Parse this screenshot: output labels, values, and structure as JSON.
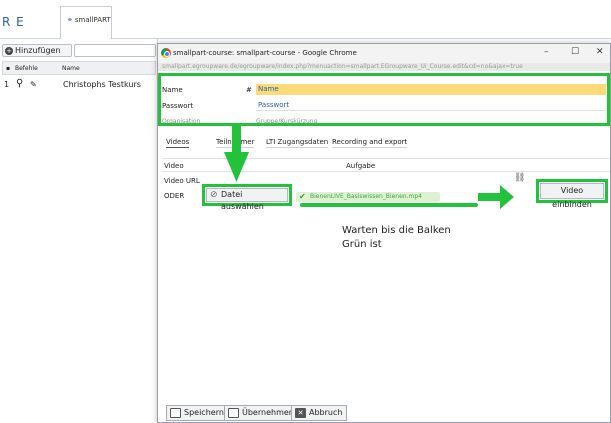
{
  "topbar": {
    "brand_partial": "R E",
    "app_tab_label": "smallPART"
  },
  "left_panel": {
    "add_button": "Hinzufügen",
    "columns": [
      "Befehle",
      "Name"
    ],
    "rows": [
      {
        "id": "1",
        "name": "Christophs Testkurs"
      }
    ]
  },
  "chrome_window": {
    "title": "smallpart-course: smallpart-course - Google Chrome",
    "url_text": "smallpart.egroupware.de/egroupware/index.php?menuaction=smallpart.EGroupware_Ui_Course.edit&cd=no&ajax=true",
    "controls": [
      "–",
      "☐",
      "✕"
    ]
  },
  "form": {
    "name_label": "Name",
    "name_hash": "#",
    "name_placeholder": "Name",
    "password_label": "Passwort",
    "password_placeholder": "Passwort",
    "org_label": "Organisation",
    "group_label": "Gruppe/Kurskürzung"
  },
  "tabs": [
    "Videos",
    "Teilnehmer",
    "LTI Zugangsdaten",
    "Recording and export"
  ],
  "video_table": {
    "col_video": "Video",
    "col_task": "Aufgabe",
    "url_label": "Video URL",
    "oder_label": "ODER",
    "select_file_button": "Datei auswählen",
    "uploaded_file": "BienenLIVE_Basiswissen_Bienen.mp4",
    "embed_button": "Video einbinden"
  },
  "annotation": {
    "line1": "Warten bis die Balken",
    "line2": "Grün ist"
  },
  "footer_buttons": {
    "save": "Speichern",
    "apply": "Übernehmen",
    "cancel": "Abbruch"
  },
  "colors": {
    "highlight_green": "#22c33a",
    "field_yellow": "#fbdb79",
    "link_blue": "#2a5db0"
  }
}
